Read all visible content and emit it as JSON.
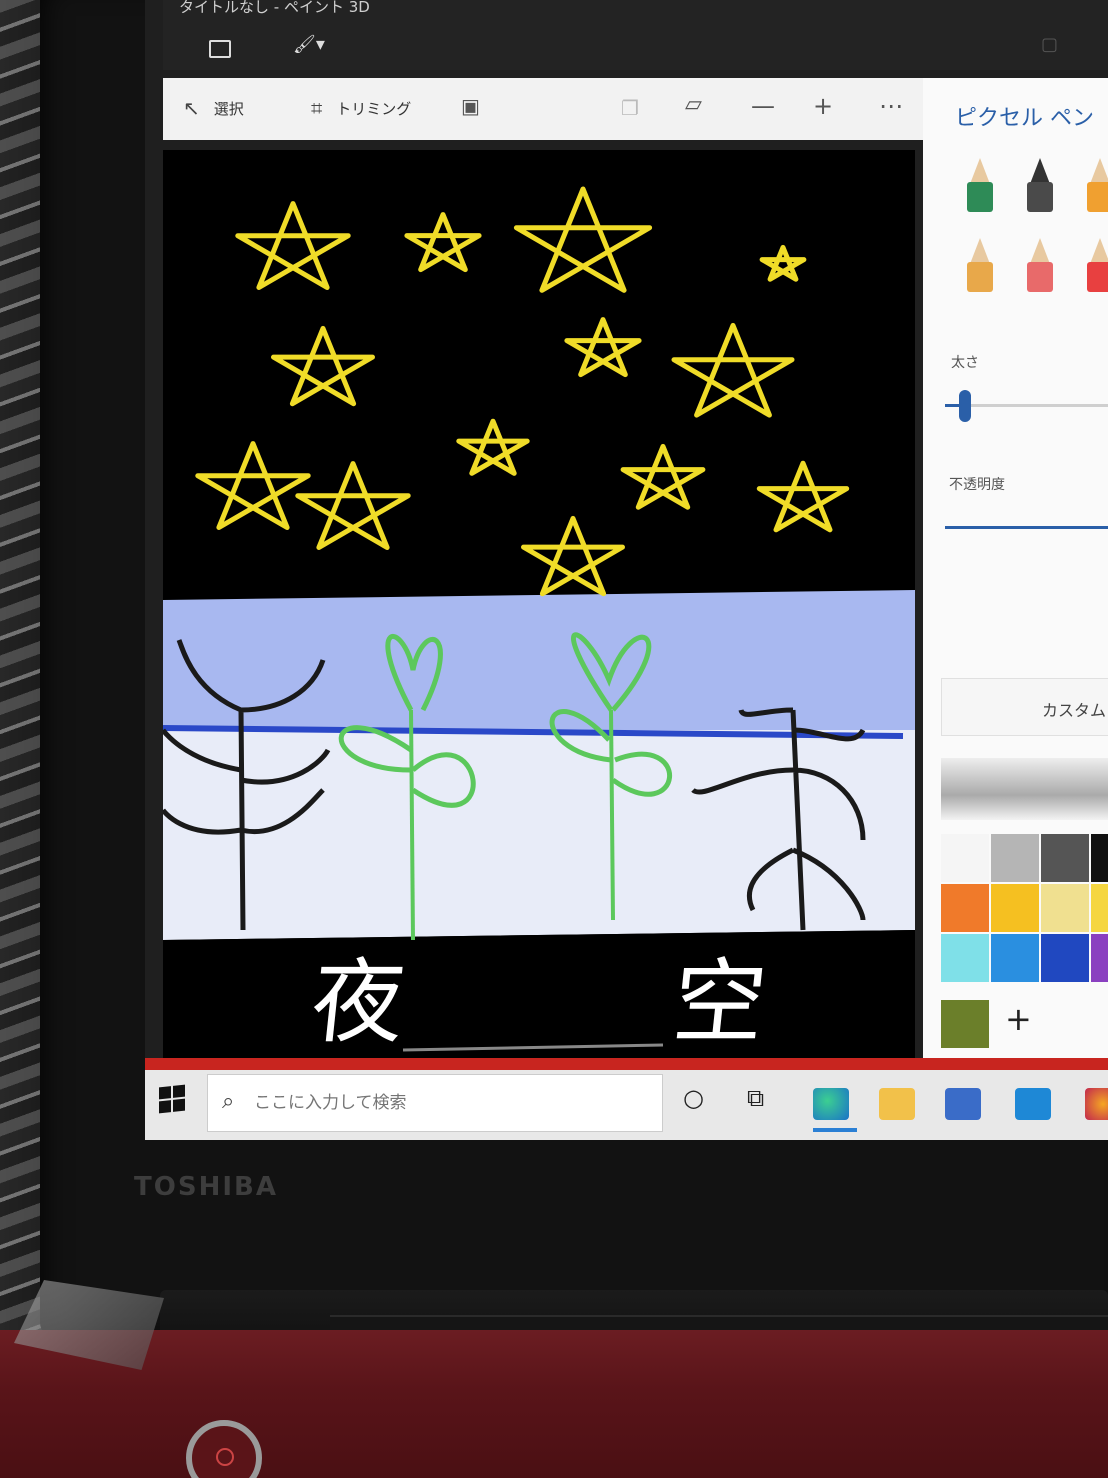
{
  "window": {
    "title": "タイトルなし - ペイント 3D"
  },
  "toolbar": {
    "select_label": "選択",
    "crop_label": "トリミング"
  },
  "panel": {
    "title": "ピクセル ペン",
    "thickness_label": "太さ",
    "thickness_value": 0.1,
    "opacity_label": "不透明度",
    "opacity_value": 1.0,
    "custom_label": "カスタム",
    "brushes": [
      {
        "name": "marker",
        "color": "#2e8b57"
      },
      {
        "name": "calligraphy-pen",
        "color": "#4a4a4a"
      },
      {
        "name": "oil-brush",
        "color": "#f0a030"
      },
      {
        "name": "pencil",
        "color": "#e8a84a"
      },
      {
        "name": "eraser",
        "color": "#e86a6a"
      },
      {
        "name": "crayon",
        "color": "#e84040"
      }
    ],
    "swatches": [
      "#f5f5f5",
      "#b5b5b5",
      "#555555",
      "#111111",
      "#f07a2a",
      "#f5c021",
      "#f0e090",
      "#f5d640",
      "#7fe0e8",
      "#2a8fe0",
      "#2048c0",
      "#8a40c0"
    ],
    "current_color": "#6b7f2a"
  },
  "canvas": {
    "text": "夜 空",
    "sky_color": "#000000",
    "star_color": "#f0dc28",
    "band_color": "#a8b8f0",
    "ground_color": "#e8ecf8",
    "plant_colors": {
      "green": "#5cc85c",
      "black": "#1a1a1a"
    }
  },
  "taskbar": {
    "search_placeholder": "ここに入力して検索"
  },
  "laptop": {
    "brand": "TOSHIBA"
  }
}
